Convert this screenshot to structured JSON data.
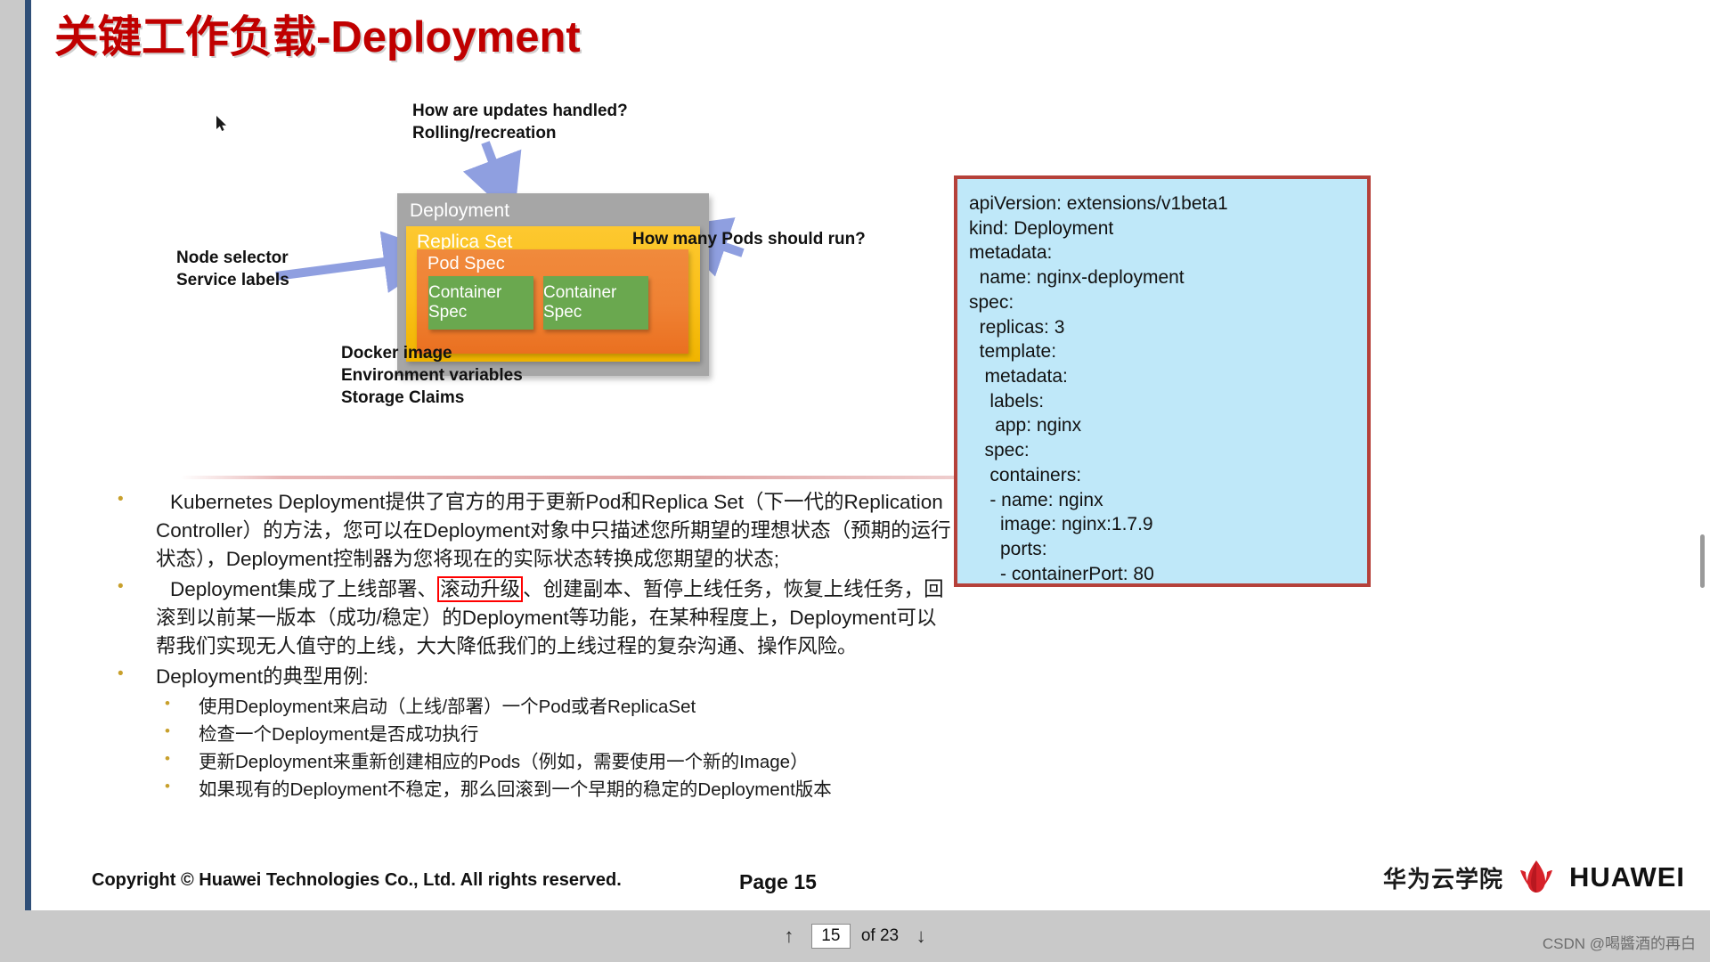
{
  "slide": {
    "title": "关键工作负载-Deployment",
    "diagram": {
      "deployment_label": "Deployment",
      "replicaset_label": "Replica Set",
      "podspec_label": "Pod Spec",
      "container_spec_1": "Container\nSpec",
      "container_spec_2": "Container\nSpec",
      "note_updates": "How are updates handled?\nRolling/recreation",
      "note_pods": "How many Pods should run?",
      "note_node": "Node selector\nService labels",
      "note_docker": "Docker image\nEnvironment variables\nStorage Claims",
      "colors": {
        "deployment": "#a6a6a6",
        "replicaset": "#fac018",
        "podspec": "#ef8133",
        "container": "#6aa84f",
        "arrow": "#8f9fe0"
      }
    },
    "bullets": {
      "b1_part1": "Kubernetes Deployment提供了官方的用于更新Pod和Replica Set（下一代的Replication Controller）的方法，您可以在Deployment对象中只描述您所期望的理想状态（预期的运行状态），Deployment控制器为您将现在的实际状态转换成您期望的状态;",
      "b2_lead": "Deployment集成了上线部署、",
      "b2_highlight": "滚动升级",
      "b2_rest": "、创建副本、暂停上线任务，恢复上线任务，回滚到以前某一版本（成功/稳定）的Deployment等功能，在某种程度上，Deployment可以帮我们实现无人值守的上线，大大降低我们的上线过程的复杂沟通、操作风险。",
      "b3": "Deployment的典型用例:",
      "sub": [
        "使用Deployment来启动（上线/部署）一个Pod或者ReplicaSet",
        "检查一个Deployment是否成功执行",
        "更新Deployment来重新创建相应的Pods（例如，需要使用一个新的Image）",
        "如果现有的Deployment不稳定，那么回滚到一个早期的稳定的Deployment版本"
      ]
    },
    "yaml": "apiVersion: extensions/v1beta1\nkind: Deployment\nmetadata:\n  name: nginx-deployment\nspec:\n  replicas: 3\n  template:\n   metadata:\n    labels:\n     app: nginx\n   spec:\n    containers:\n    - name: nginx\n      image: nginx:1.7.9\n      ports:\n      - containerPort: 80",
    "footer": {
      "copyright": "Copyright © Huawei Technologies Co., Ltd. All rights reserved.",
      "page_label": "Page 15",
      "brand_cn": "华为云学院",
      "brand_en": "HUAWEI"
    }
  },
  "toolbar": {
    "prev_icon": "↑",
    "current_page": "15",
    "of_label": "of 23",
    "next_icon": "↓",
    "watermark": "CSDN @喝醬酒的再白"
  }
}
